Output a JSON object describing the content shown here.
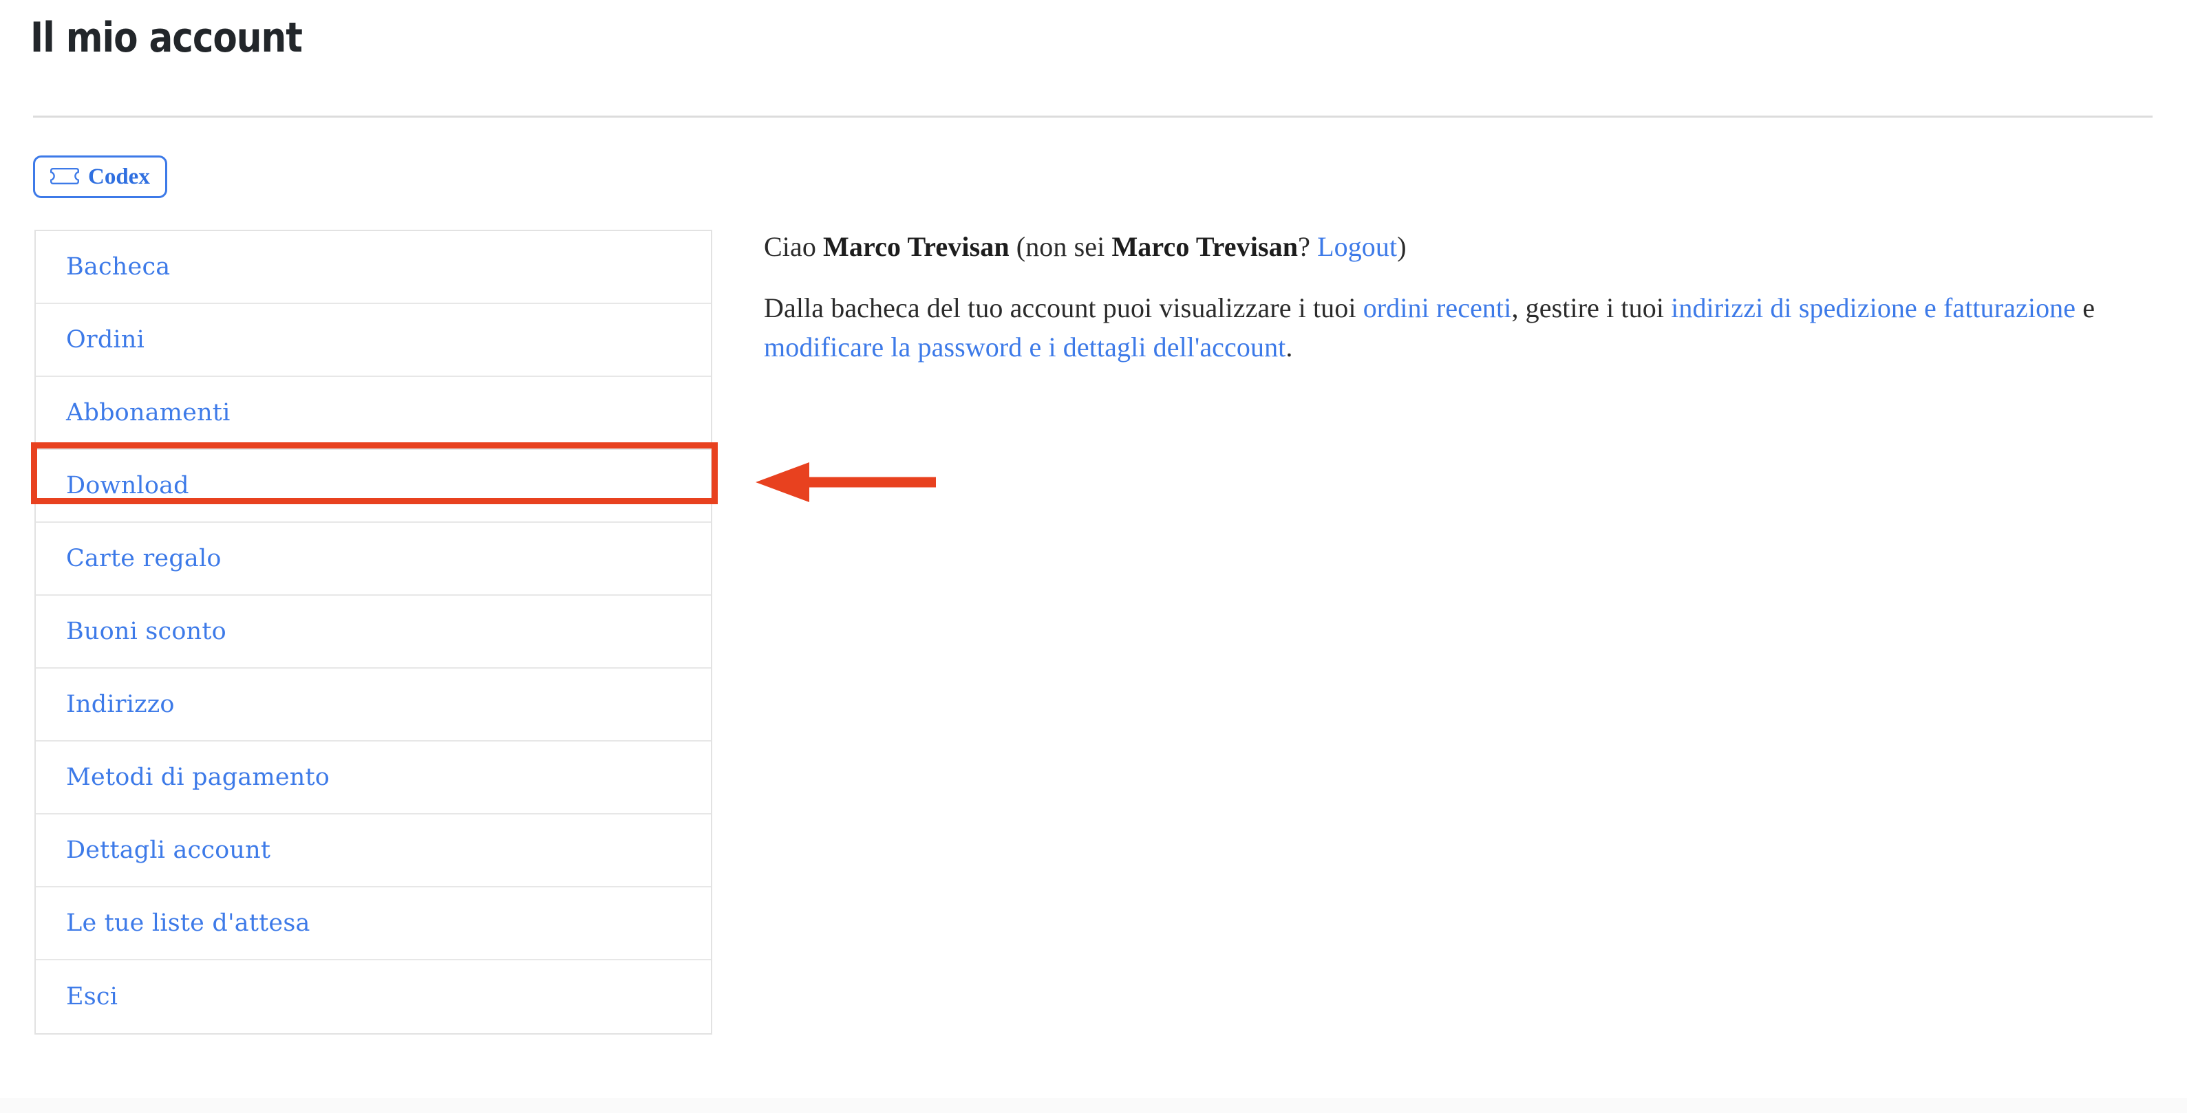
{
  "page": {
    "title": "Il mio account"
  },
  "chip": {
    "label": "Codex",
    "icon": "ticket-icon",
    "border_color": "#3d7ae8",
    "text_color": "#2f6fe0"
  },
  "sidebar": {
    "items": [
      {
        "label": "Bacheca"
      },
      {
        "label": "Ordini"
      },
      {
        "label": "Abbonamenti"
      },
      {
        "label": "Download"
      },
      {
        "label": "Carte regalo"
      },
      {
        "label": "Buoni sconto"
      },
      {
        "label": "Indirizzo"
      },
      {
        "label": "Metodi di pagamento"
      },
      {
        "label": "Dettagli account"
      },
      {
        "label": "Le tue liste d'attesa"
      },
      {
        "label": "Esci"
      }
    ],
    "link_color": "#3d7ae8",
    "highlighted_item": "Download"
  },
  "main": {
    "greeting": {
      "prefix": "Ciao ",
      "user_name": "Marco Trevisan",
      "middle": " (non sei ",
      "user_name_2": "Marco Trevisan",
      "question": "? ",
      "logout_label": "Logout",
      "suffix": ")"
    },
    "intro": {
      "part1": "Dalla bacheca del tuo account puoi visualizzare i tuoi ",
      "link_orders": "ordini recenti",
      "part2": ", gestire i tuoi ",
      "link_addresses": "indirizzi di spedizione e fatturazione",
      "part3": " e ",
      "link_password": "modificare la password e i dettagli dell'account",
      "part4": "."
    }
  },
  "annotations": {
    "color": "#e8411f",
    "highlight_target": "Download",
    "arrow_direction": "left"
  }
}
